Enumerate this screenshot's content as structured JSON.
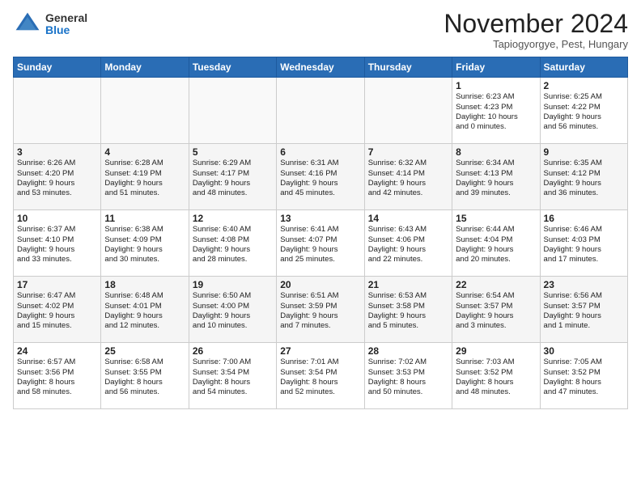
{
  "header": {
    "logo_general": "General",
    "logo_blue": "Blue",
    "month_title": "November 2024",
    "subtitle": "Tapiogyorgye, Pest, Hungary"
  },
  "calendar": {
    "days_of_week": [
      "Sunday",
      "Monday",
      "Tuesday",
      "Wednesday",
      "Thursday",
      "Friday",
      "Saturday"
    ],
    "weeks": [
      [
        {
          "day": "",
          "content": ""
        },
        {
          "day": "",
          "content": ""
        },
        {
          "day": "",
          "content": ""
        },
        {
          "day": "",
          "content": ""
        },
        {
          "day": "",
          "content": ""
        },
        {
          "day": "1",
          "content": "Sunrise: 6:23 AM\nSunset: 4:23 PM\nDaylight: 10 hours\nand 0 minutes."
        },
        {
          "day": "2",
          "content": "Sunrise: 6:25 AM\nSunset: 4:22 PM\nDaylight: 9 hours\nand 56 minutes."
        }
      ],
      [
        {
          "day": "3",
          "content": "Sunrise: 6:26 AM\nSunset: 4:20 PM\nDaylight: 9 hours\nand 53 minutes."
        },
        {
          "day": "4",
          "content": "Sunrise: 6:28 AM\nSunset: 4:19 PM\nDaylight: 9 hours\nand 51 minutes."
        },
        {
          "day": "5",
          "content": "Sunrise: 6:29 AM\nSunset: 4:17 PM\nDaylight: 9 hours\nand 48 minutes."
        },
        {
          "day": "6",
          "content": "Sunrise: 6:31 AM\nSunset: 4:16 PM\nDaylight: 9 hours\nand 45 minutes."
        },
        {
          "day": "7",
          "content": "Sunrise: 6:32 AM\nSunset: 4:14 PM\nDaylight: 9 hours\nand 42 minutes."
        },
        {
          "day": "8",
          "content": "Sunrise: 6:34 AM\nSunset: 4:13 PM\nDaylight: 9 hours\nand 39 minutes."
        },
        {
          "day": "9",
          "content": "Sunrise: 6:35 AM\nSunset: 4:12 PM\nDaylight: 9 hours\nand 36 minutes."
        }
      ],
      [
        {
          "day": "10",
          "content": "Sunrise: 6:37 AM\nSunset: 4:10 PM\nDaylight: 9 hours\nand 33 minutes."
        },
        {
          "day": "11",
          "content": "Sunrise: 6:38 AM\nSunset: 4:09 PM\nDaylight: 9 hours\nand 30 minutes."
        },
        {
          "day": "12",
          "content": "Sunrise: 6:40 AM\nSunset: 4:08 PM\nDaylight: 9 hours\nand 28 minutes."
        },
        {
          "day": "13",
          "content": "Sunrise: 6:41 AM\nSunset: 4:07 PM\nDaylight: 9 hours\nand 25 minutes."
        },
        {
          "day": "14",
          "content": "Sunrise: 6:43 AM\nSunset: 4:06 PM\nDaylight: 9 hours\nand 22 minutes."
        },
        {
          "day": "15",
          "content": "Sunrise: 6:44 AM\nSunset: 4:04 PM\nDaylight: 9 hours\nand 20 minutes."
        },
        {
          "day": "16",
          "content": "Sunrise: 6:46 AM\nSunset: 4:03 PM\nDaylight: 9 hours\nand 17 minutes."
        }
      ],
      [
        {
          "day": "17",
          "content": "Sunrise: 6:47 AM\nSunset: 4:02 PM\nDaylight: 9 hours\nand 15 minutes."
        },
        {
          "day": "18",
          "content": "Sunrise: 6:48 AM\nSunset: 4:01 PM\nDaylight: 9 hours\nand 12 minutes."
        },
        {
          "day": "19",
          "content": "Sunrise: 6:50 AM\nSunset: 4:00 PM\nDaylight: 9 hours\nand 10 minutes."
        },
        {
          "day": "20",
          "content": "Sunrise: 6:51 AM\nSunset: 3:59 PM\nDaylight: 9 hours\nand 7 minutes."
        },
        {
          "day": "21",
          "content": "Sunrise: 6:53 AM\nSunset: 3:58 PM\nDaylight: 9 hours\nand 5 minutes."
        },
        {
          "day": "22",
          "content": "Sunrise: 6:54 AM\nSunset: 3:57 PM\nDaylight: 9 hours\nand 3 minutes."
        },
        {
          "day": "23",
          "content": "Sunrise: 6:56 AM\nSunset: 3:57 PM\nDaylight: 9 hours\nand 1 minute."
        }
      ],
      [
        {
          "day": "24",
          "content": "Sunrise: 6:57 AM\nSunset: 3:56 PM\nDaylight: 8 hours\nand 58 minutes."
        },
        {
          "day": "25",
          "content": "Sunrise: 6:58 AM\nSunset: 3:55 PM\nDaylight: 8 hours\nand 56 minutes."
        },
        {
          "day": "26",
          "content": "Sunrise: 7:00 AM\nSunset: 3:54 PM\nDaylight: 8 hours\nand 54 minutes."
        },
        {
          "day": "27",
          "content": "Sunrise: 7:01 AM\nSunset: 3:54 PM\nDaylight: 8 hours\nand 52 minutes."
        },
        {
          "day": "28",
          "content": "Sunrise: 7:02 AM\nSunset: 3:53 PM\nDaylight: 8 hours\nand 50 minutes."
        },
        {
          "day": "29",
          "content": "Sunrise: 7:03 AM\nSunset: 3:52 PM\nDaylight: 8 hours\nand 48 minutes."
        },
        {
          "day": "30",
          "content": "Sunrise: 7:05 AM\nSunset: 3:52 PM\nDaylight: 8 hours\nand 47 minutes."
        }
      ]
    ]
  }
}
